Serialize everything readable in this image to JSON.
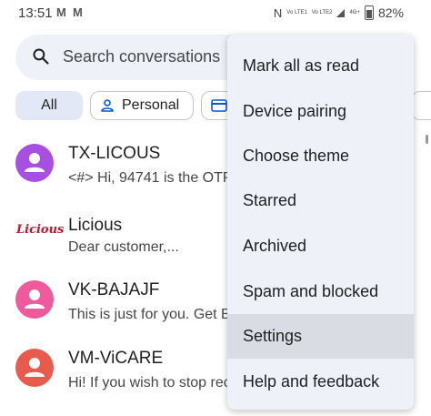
{
  "status_bar": {
    "time": "13:51",
    "notif_icons": "M M",
    "sim1": "Vo LTE1",
    "sim2": "Vo LTE2",
    "net": "4G+",
    "battery": "82%"
  },
  "search": {
    "placeholder": "Search conversations"
  },
  "chips": [
    {
      "label": "All"
    },
    {
      "label": "Personal"
    }
  ],
  "conversations": [
    {
      "name": "TX-LICOUS",
      "snippet": "<#> Hi, 94741 is the OTP",
      "avatar_color": "#a64fe0"
    },
    {
      "name": "Licious",
      "snippet": "Dear customer,...",
      "logo_text": "Licious"
    },
    {
      "name": "VK-BAJAJF",
      "snippet": "This is just for you. Get B",
      "avatar_color": "#ee5a9b"
    },
    {
      "name": "VM-ViCARE",
      "snippet": "Hi! If you wish to stop rec",
      "avatar_color": "#e75b4f"
    }
  ],
  "menu": {
    "items": [
      {
        "label": "Mark all as read"
      },
      {
        "label": "Device pairing"
      },
      {
        "label": "Choose theme"
      },
      {
        "label": "Starred"
      },
      {
        "label": "Archived"
      },
      {
        "label": "Spam and blocked"
      },
      {
        "label": "Settings",
        "highlighted": true
      },
      {
        "label": "Help and feedback"
      }
    ]
  },
  "colors": {
    "menu_bg": "#eef1f8",
    "highlight": "#d9dce3",
    "accent": "#0b57d0"
  }
}
